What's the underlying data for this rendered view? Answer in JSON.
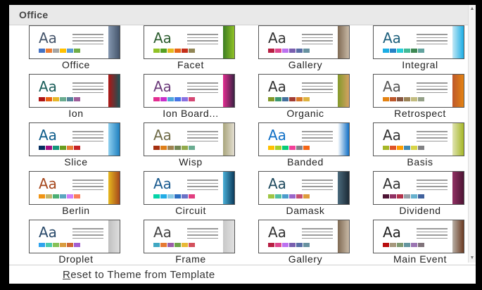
{
  "header": {
    "title": "Office"
  },
  "colors": {
    "swatch_default": [
      "#4472c4",
      "#ed7d31",
      "#a5a5a5",
      "#ffc000",
      "#5b9bd5",
      "#70ad47"
    ]
  },
  "themes": [
    {
      "name": "Office",
      "aa_color": "#44546a",
      "accent": "#44546a",
      "accent2": "#8497b0",
      "swatches": [
        "#4472c4",
        "#ed7d31",
        "#a5a5a5",
        "#ffc000",
        "#5b9bd5",
        "#70ad47"
      ]
    },
    {
      "name": "Facet",
      "aa_color": "#2c5d2f",
      "accent": "#90c226",
      "accent2": "#3b7d23",
      "swatches": [
        "#90c226",
        "#54a021",
        "#e6b91e",
        "#e76618",
        "#c42f1a",
        "#918655"
      ]
    },
    {
      "name": "Gallery",
      "aa_color": "#333333",
      "accent": "#c8b9a6",
      "accent2": "#7f6a53",
      "swatches": [
        "#b71e42",
        "#de478e",
        "#bc72f0",
        "#795faf",
        "#586ea6",
        "#6892a0"
      ]
    },
    {
      "name": "Integral",
      "aa_color": "#1c5f7c",
      "accent": "#1cade4",
      "accent2": "#c3e8f5",
      "swatches": [
        "#1cade4",
        "#2683c6",
        "#27ced7",
        "#42ba97",
        "#3e8853",
        "#62a39f"
      ]
    },
    {
      "name": "Ion",
      "aa_color": "#1b5e5a",
      "accent": "#1e5155",
      "accent2": "#b01513",
      "swatches": [
        "#b01513",
        "#ea6312",
        "#e6b729",
        "#6aac90",
        "#54849a",
        "#9e5e9b"
      ]
    },
    {
      "name": "Ion Board...",
      "aa_color": "#6b3a7a",
      "accent": "#3b2144",
      "accent2": "#e32d91",
      "swatches": [
        "#e32d91",
        "#c830cc",
        "#4ea6dc",
        "#4775e7",
        "#8971e1",
        "#d54773"
      ]
    },
    {
      "name": "Organic",
      "aa_color": "#333333",
      "accent": "#d4a262",
      "accent2": "#83992a",
      "swatches": [
        "#83992a",
        "#3c9770",
        "#44709d",
        "#a23c33",
        "#d97828",
        "#deb340"
      ]
    },
    {
      "name": "Retrospect",
      "aa_color": "#555555",
      "accent": "#e48312",
      "accent2": "#bd582c",
      "swatches": [
        "#e48312",
        "#bd582c",
        "#865640",
        "#9b8357",
        "#c2bc80",
        "#94a088"
      ]
    },
    {
      "name": "Slice",
      "aa_color": "#0e5c8a",
      "accent": "#1d7fbf",
      "accent2": "#8fd0f0",
      "swatches": [
        "#052f61",
        "#a50e82",
        "#14967c",
        "#6a9e1f",
        "#e87d37",
        "#c62324"
      ]
    },
    {
      "name": "Wisp",
      "aa_color": "#6f6b48",
      "accent": "#e3ded1",
      "accent2": "#a9a57c",
      "swatches": [
        "#a53010",
        "#de7e18",
        "#9f8351",
        "#728653",
        "#92aa4c",
        "#6aac91"
      ]
    },
    {
      "name": "Banded",
      "aa_color": "#0f6fc6",
      "accent": "#0f6fc6",
      "accent2": "#ffffff",
      "swatches": [
        "#ffc000",
        "#a5d028",
        "#08cc78",
        "#f24099",
        "#828288",
        "#f56617"
      ]
    },
    {
      "name": "Basis",
      "aa_color": "#333333",
      "accent": "#a6b727",
      "accent2": "#dfe3b1",
      "swatches": [
        "#a6b727",
        "#df5327",
        "#fe9e00",
        "#418ab3",
        "#d7d447",
        "#818183"
      ]
    },
    {
      "name": "Berlin",
      "aa_color": "#a6471c",
      "accent": "#a6471c",
      "accent2": "#e6b91e",
      "swatches": [
        "#f09415",
        "#c1b56b",
        "#4baf73",
        "#5aa6c0",
        "#d17df9",
        "#fa7e5c"
      ]
    },
    {
      "name": "Circuit",
      "aa_color": "#1a5b8f",
      "accent": "#0b3a5b",
      "accent2": "#4ab0d8",
      "swatches": [
        "#03d4a8",
        "#21ace6",
        "#89c9e4",
        "#2b6ec2",
        "#6a72c7",
        "#e13d7f"
      ]
    },
    {
      "name": "Damask",
      "aa_color": "#1f4a5e",
      "accent": "#1c2a36",
      "accent2": "#4a6a7c",
      "swatches": [
        "#9ec544",
        "#50bea3",
        "#4a9ccc",
        "#9a66ca",
        "#c54f71",
        "#de9c3c"
      ]
    },
    {
      "name": "Dividend",
      "aa_color": "#333333",
      "accent": "#4d1434",
      "accent2": "#903163",
      "swatches": [
        "#4d1434",
        "#903163",
        "#b2324b",
        "#969fa7",
        "#66b1ce",
        "#40619d"
      ]
    },
    {
      "name": "Droplet",
      "aa_color": "#2a4a6b",
      "accent": "#dedede",
      "accent2": "#bfbfbf",
      "swatches": [
        "#2fa3ee",
        "#4bcaad",
        "#86c157",
        "#d99c3f",
        "#ce6633",
        "#a35dd1"
      ]
    },
    {
      "name": "Frame",
      "aa_color": "#444444",
      "accent": "#e0e0e0",
      "accent2": "#c8c8c8",
      "swatches": [
        "#40a7c2",
        "#e67a32",
        "#9c5ea8",
        "#6ea349",
        "#e8b936",
        "#d3505c"
      ]
    },
    {
      "name": "Gallery",
      "aa_color": "#333333",
      "accent": "#c8b9a6",
      "accent2": "#7f6a53",
      "swatches": [
        "#b71e42",
        "#de478e",
        "#bc72f0",
        "#795faf",
        "#586ea6",
        "#6892a0"
      ]
    },
    {
      "name": "Main Event",
      "aa_color": "#222222",
      "accent": "#6b3b22",
      "accent2": "#b8b0a6",
      "swatches": [
        "#b80e0f",
        "#a6987d",
        "#7f9a71",
        "#64969f",
        "#9b75b2",
        "#80737a"
      ]
    }
  ],
  "footer": {
    "reset_mnemonic": "R",
    "reset_rest": "eset to Theme from Template"
  }
}
